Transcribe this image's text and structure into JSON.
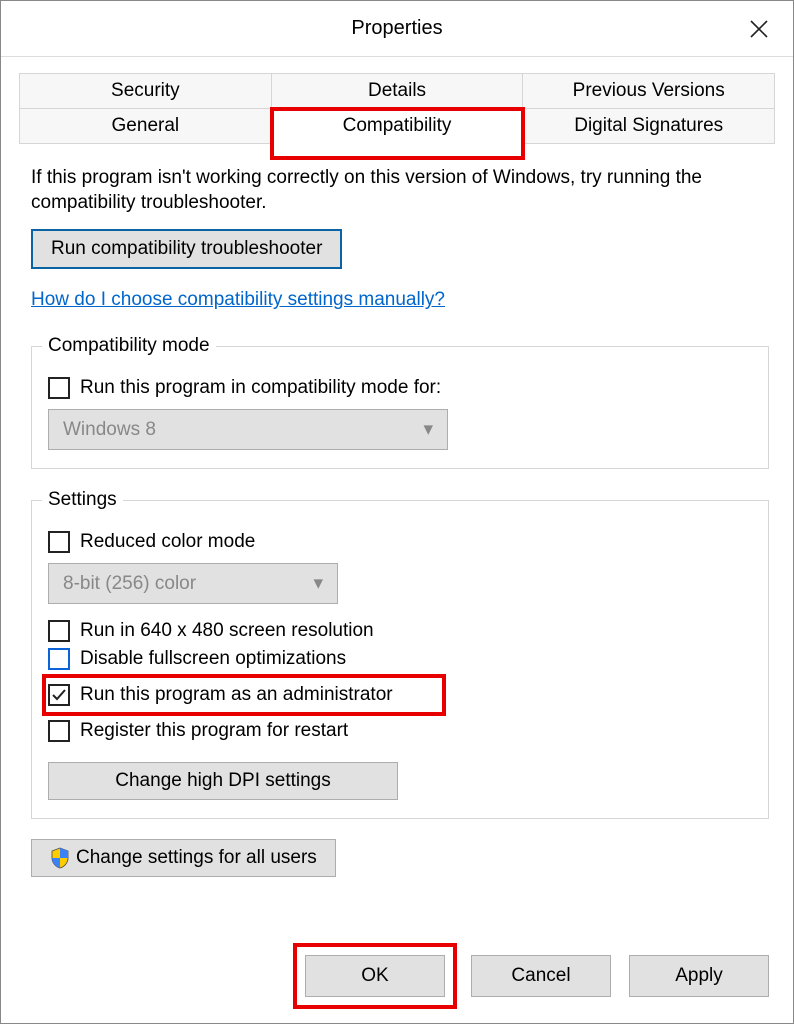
{
  "window": {
    "title": "Properties"
  },
  "tabs": {
    "row1": [
      "Security",
      "Details",
      "Previous Versions"
    ],
    "row2": [
      "General",
      "Compatibility",
      "Digital Signatures"
    ],
    "active": "Compatibility"
  },
  "main": {
    "intro": "If this program isn't working correctly on this version of Windows, try running the compatibility troubleshooter.",
    "troubleshooter_button": "Run compatibility troubleshooter",
    "help_link": "How do I choose compatibility settings manually?"
  },
  "compat_mode": {
    "legend": "Compatibility mode",
    "checkbox_label": "Run this program in compatibility mode for:",
    "dropdown_value": "Windows 8"
  },
  "settings": {
    "legend": "Settings",
    "reduced_color": "Reduced color mode",
    "color_dropdown": "8-bit (256) color",
    "resolution": "Run in 640 x 480 screen resolution",
    "disable_fullscreen": "Disable fullscreen optimizations",
    "run_admin": "Run this program as an administrator",
    "register_restart": "Register this program for restart",
    "dpi_button": "Change high DPI settings"
  },
  "all_users_button": "Change settings for all users",
  "footer": {
    "ok": "OK",
    "cancel": "Cancel",
    "apply": "Apply"
  }
}
